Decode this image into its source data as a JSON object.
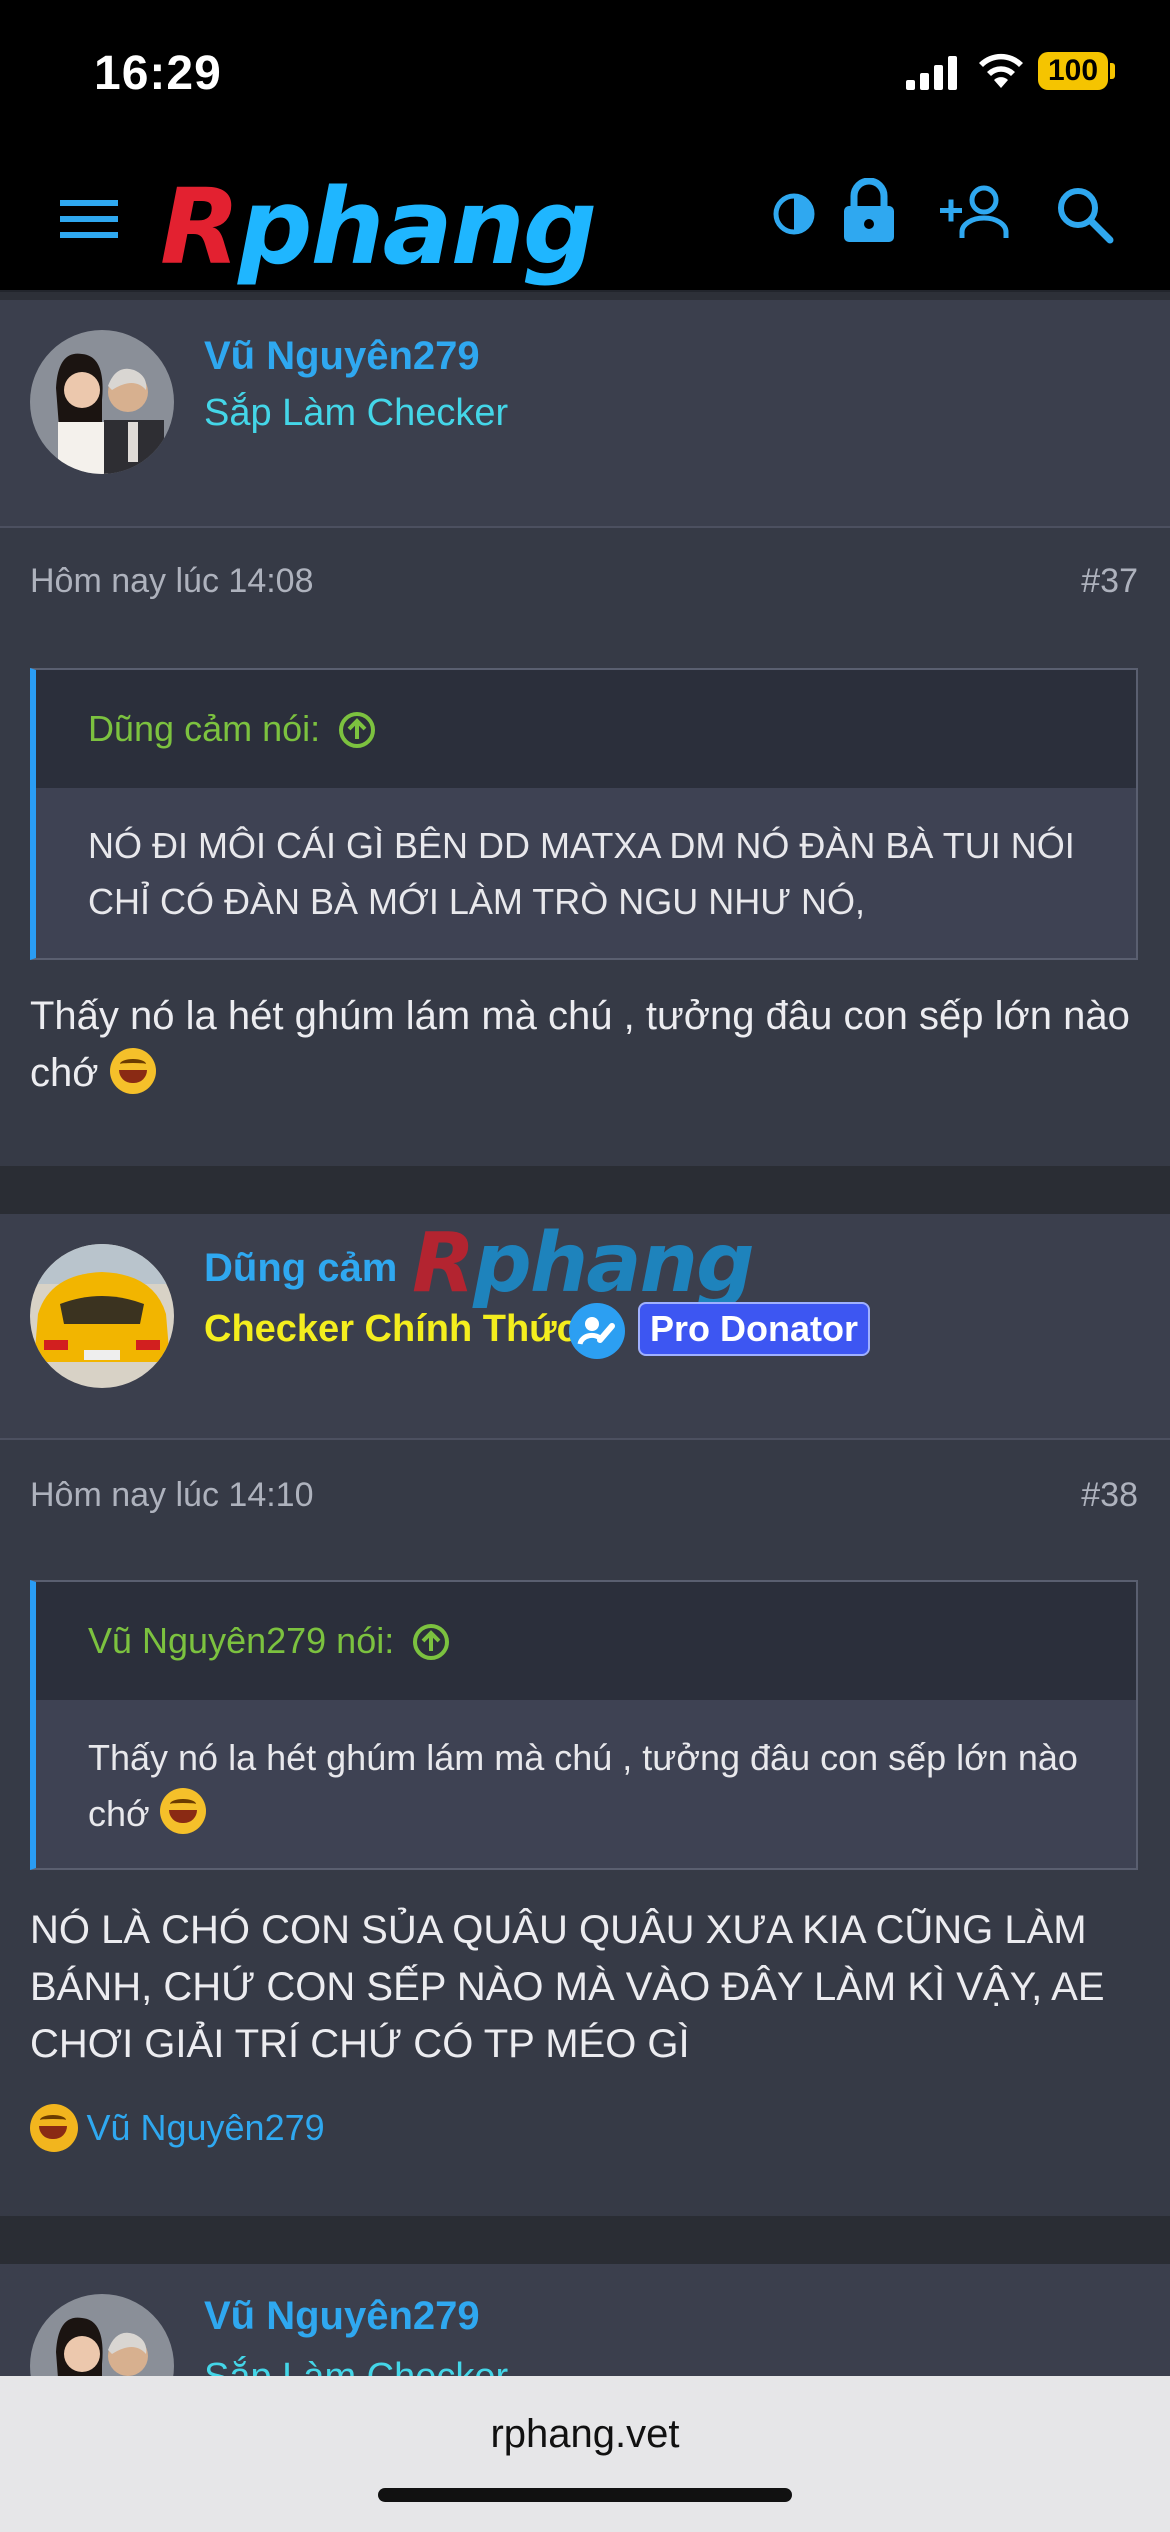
{
  "status": {
    "time": "16:29",
    "battery": "100"
  },
  "header": {
    "logo_first": "R",
    "logo_rest": "phang",
    "icons": [
      "menu-icon",
      "contrast-icon",
      "lock-icon",
      "add-user-icon",
      "search-icon"
    ]
  },
  "posts": [
    {
      "author": "Vũ Nguyên279",
      "user_title": "Sắp Làm Checker",
      "date": "Hôm nay lúc 14:08",
      "number": "#37",
      "quote_author": "Dũng cảm nói:",
      "quote_text": "NÓ ĐI MÔI CÁI GÌ BÊN DD MATXA DM NÓ ĐÀN BÀ TUI NÓI CHỈ CÓ ĐÀN BÀ MỚI LÀM TRÒ NGU NHƯ NÓ,",
      "body_text": "Thấy nó la hét ghúm lám mà chú , tưởng đâu con sếp lớn nào chớ"
    },
    {
      "author": "Dũng cảm",
      "user_title": "Checker Chính Thức",
      "badge": "Pro Donator",
      "date": "Hôm nay lúc 14:10",
      "number": "#38",
      "quote_author": "Vũ Nguyên279 nói:",
      "quote_text": "Thấy nó la hét ghúm lám mà chú , tưởng đâu con sếp lớn nào chớ",
      "body_text": "NÓ LÀ CHÓ CON SỦA QUÂU QUÂU XƯA KIA CŨNG LÀM BÁNH, CHỨ CON SẾP NÀO MÀ VÀO ĐÂY LÀM KÌ VẬY, AE CHƠI GIẢI TRÍ CHỨ CÓ TP MÉO GÌ",
      "reaction_user": "Vũ Nguyên279"
    },
    {
      "author": "Vũ Nguyên279",
      "user_title": "Sắp Làm Checker"
    }
  ],
  "watermark": {
    "first": "R",
    "rest": "phang"
  },
  "browser": {
    "url": "rphang.vet"
  }
}
